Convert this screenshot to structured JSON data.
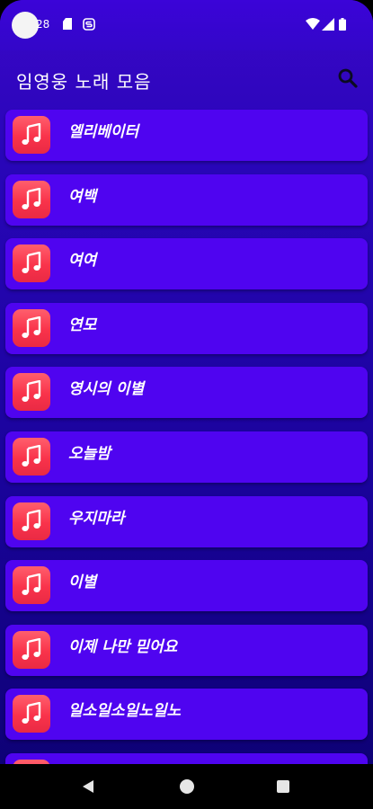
{
  "status_bar": {
    "time": "28",
    "icons": [
      "sd-card-icon",
      "s-app-icon",
      "wifi-icon",
      "signal-icon",
      "battery-icon"
    ]
  },
  "app_bar": {
    "title": "임영웅 노래 모음",
    "search_icon": "search-icon"
  },
  "songs": [
    {
      "title": "엘리베이터"
    },
    {
      "title": "여백"
    },
    {
      "title": "여여"
    },
    {
      "title": "연모"
    },
    {
      "title": "영시의 이별"
    },
    {
      "title": "오늘밤"
    },
    {
      "title": "우지마라"
    },
    {
      "title": "이별"
    },
    {
      "title": "이제 나만 믿어요"
    },
    {
      "title": "일소일소일노일노"
    },
    {
      "title": ""
    }
  ],
  "colors": {
    "background_top": "#3a07c8",
    "background_bottom": "#0c0170",
    "card": "#4f04f0",
    "music_tile": "#f9334b",
    "text": "#ffffff"
  },
  "nav_bar": {
    "icons": [
      "back-icon",
      "home-icon",
      "recents-icon"
    ]
  }
}
